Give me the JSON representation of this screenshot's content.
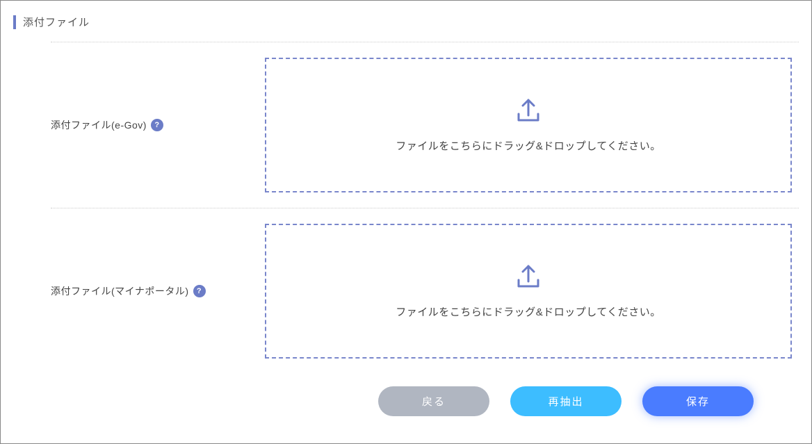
{
  "section": {
    "title": "添付ファイル"
  },
  "rows": [
    {
      "label": "添付ファイル(e-Gov)",
      "help": "?",
      "dropzone_text": "ファイルをこちらにドラッグ&ドロップしてください。"
    },
    {
      "label": "添付ファイル(マイナポータル)",
      "help": "?",
      "dropzone_text": "ファイルをこちらにドラッグ&ドロップしてください。"
    }
  ],
  "buttons": {
    "back": "戻る",
    "reextract": "再抽出",
    "save": "保存"
  }
}
